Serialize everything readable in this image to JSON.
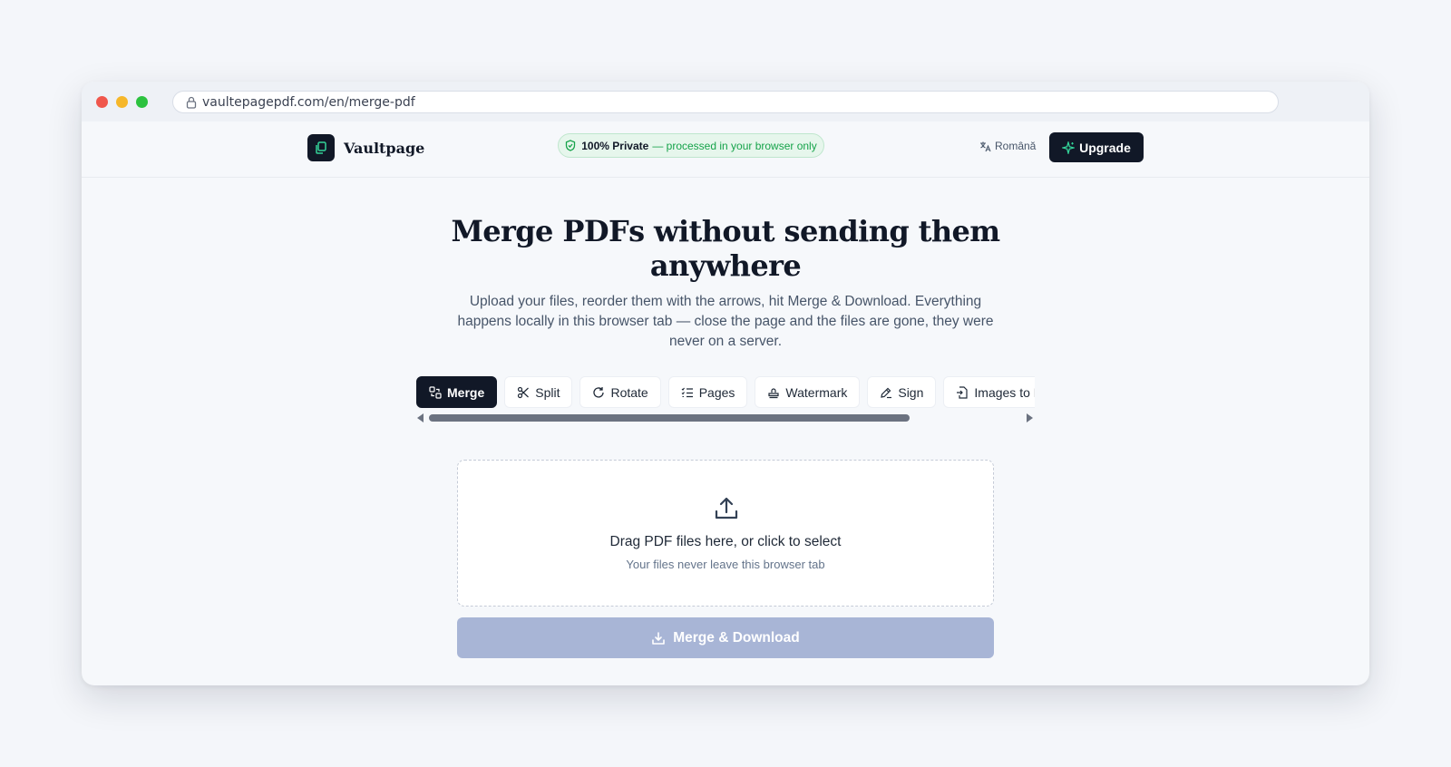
{
  "browser": {
    "url": "vaultepagepdf.com/en/merge-pdf"
  },
  "header": {
    "brand": "Vaultpage",
    "privacy_strong": "100% Private",
    "privacy_rest": "— processed in your browser only",
    "language": "Română",
    "upgrade_label": "Upgrade"
  },
  "hero": {
    "title": "Merge PDFs without sending them anywhere",
    "subtitle": "Upload your files, reorder them with the arrows, hit Merge & Download. Everything happens locally in this browser tab — close the page and the files are gone, they were never on a server."
  },
  "tabs": [
    {
      "label": "Merge",
      "icon": "merge-icon",
      "active": true
    },
    {
      "label": "Split",
      "icon": "scissors-icon",
      "active": false
    },
    {
      "label": "Rotate",
      "icon": "rotate-icon",
      "active": false
    },
    {
      "label": "Pages",
      "icon": "list-icon",
      "active": false
    },
    {
      "label": "Watermark",
      "icon": "stamp-icon",
      "active": false
    },
    {
      "label": "Sign",
      "icon": "signature-icon",
      "active": false
    },
    {
      "label": "Images to PDF",
      "icon": "file-import-icon",
      "active": false
    }
  ],
  "dropzone": {
    "title": "Drag PDF files here, or click to select",
    "subtitle": "Your files never leave this browser tab"
  },
  "actions": {
    "merge_download": "Merge & Download"
  },
  "colors": {
    "primary_dark": "#111827",
    "privacy_green": "#16a34a",
    "disabled_button": "#a8b5d6"
  }
}
